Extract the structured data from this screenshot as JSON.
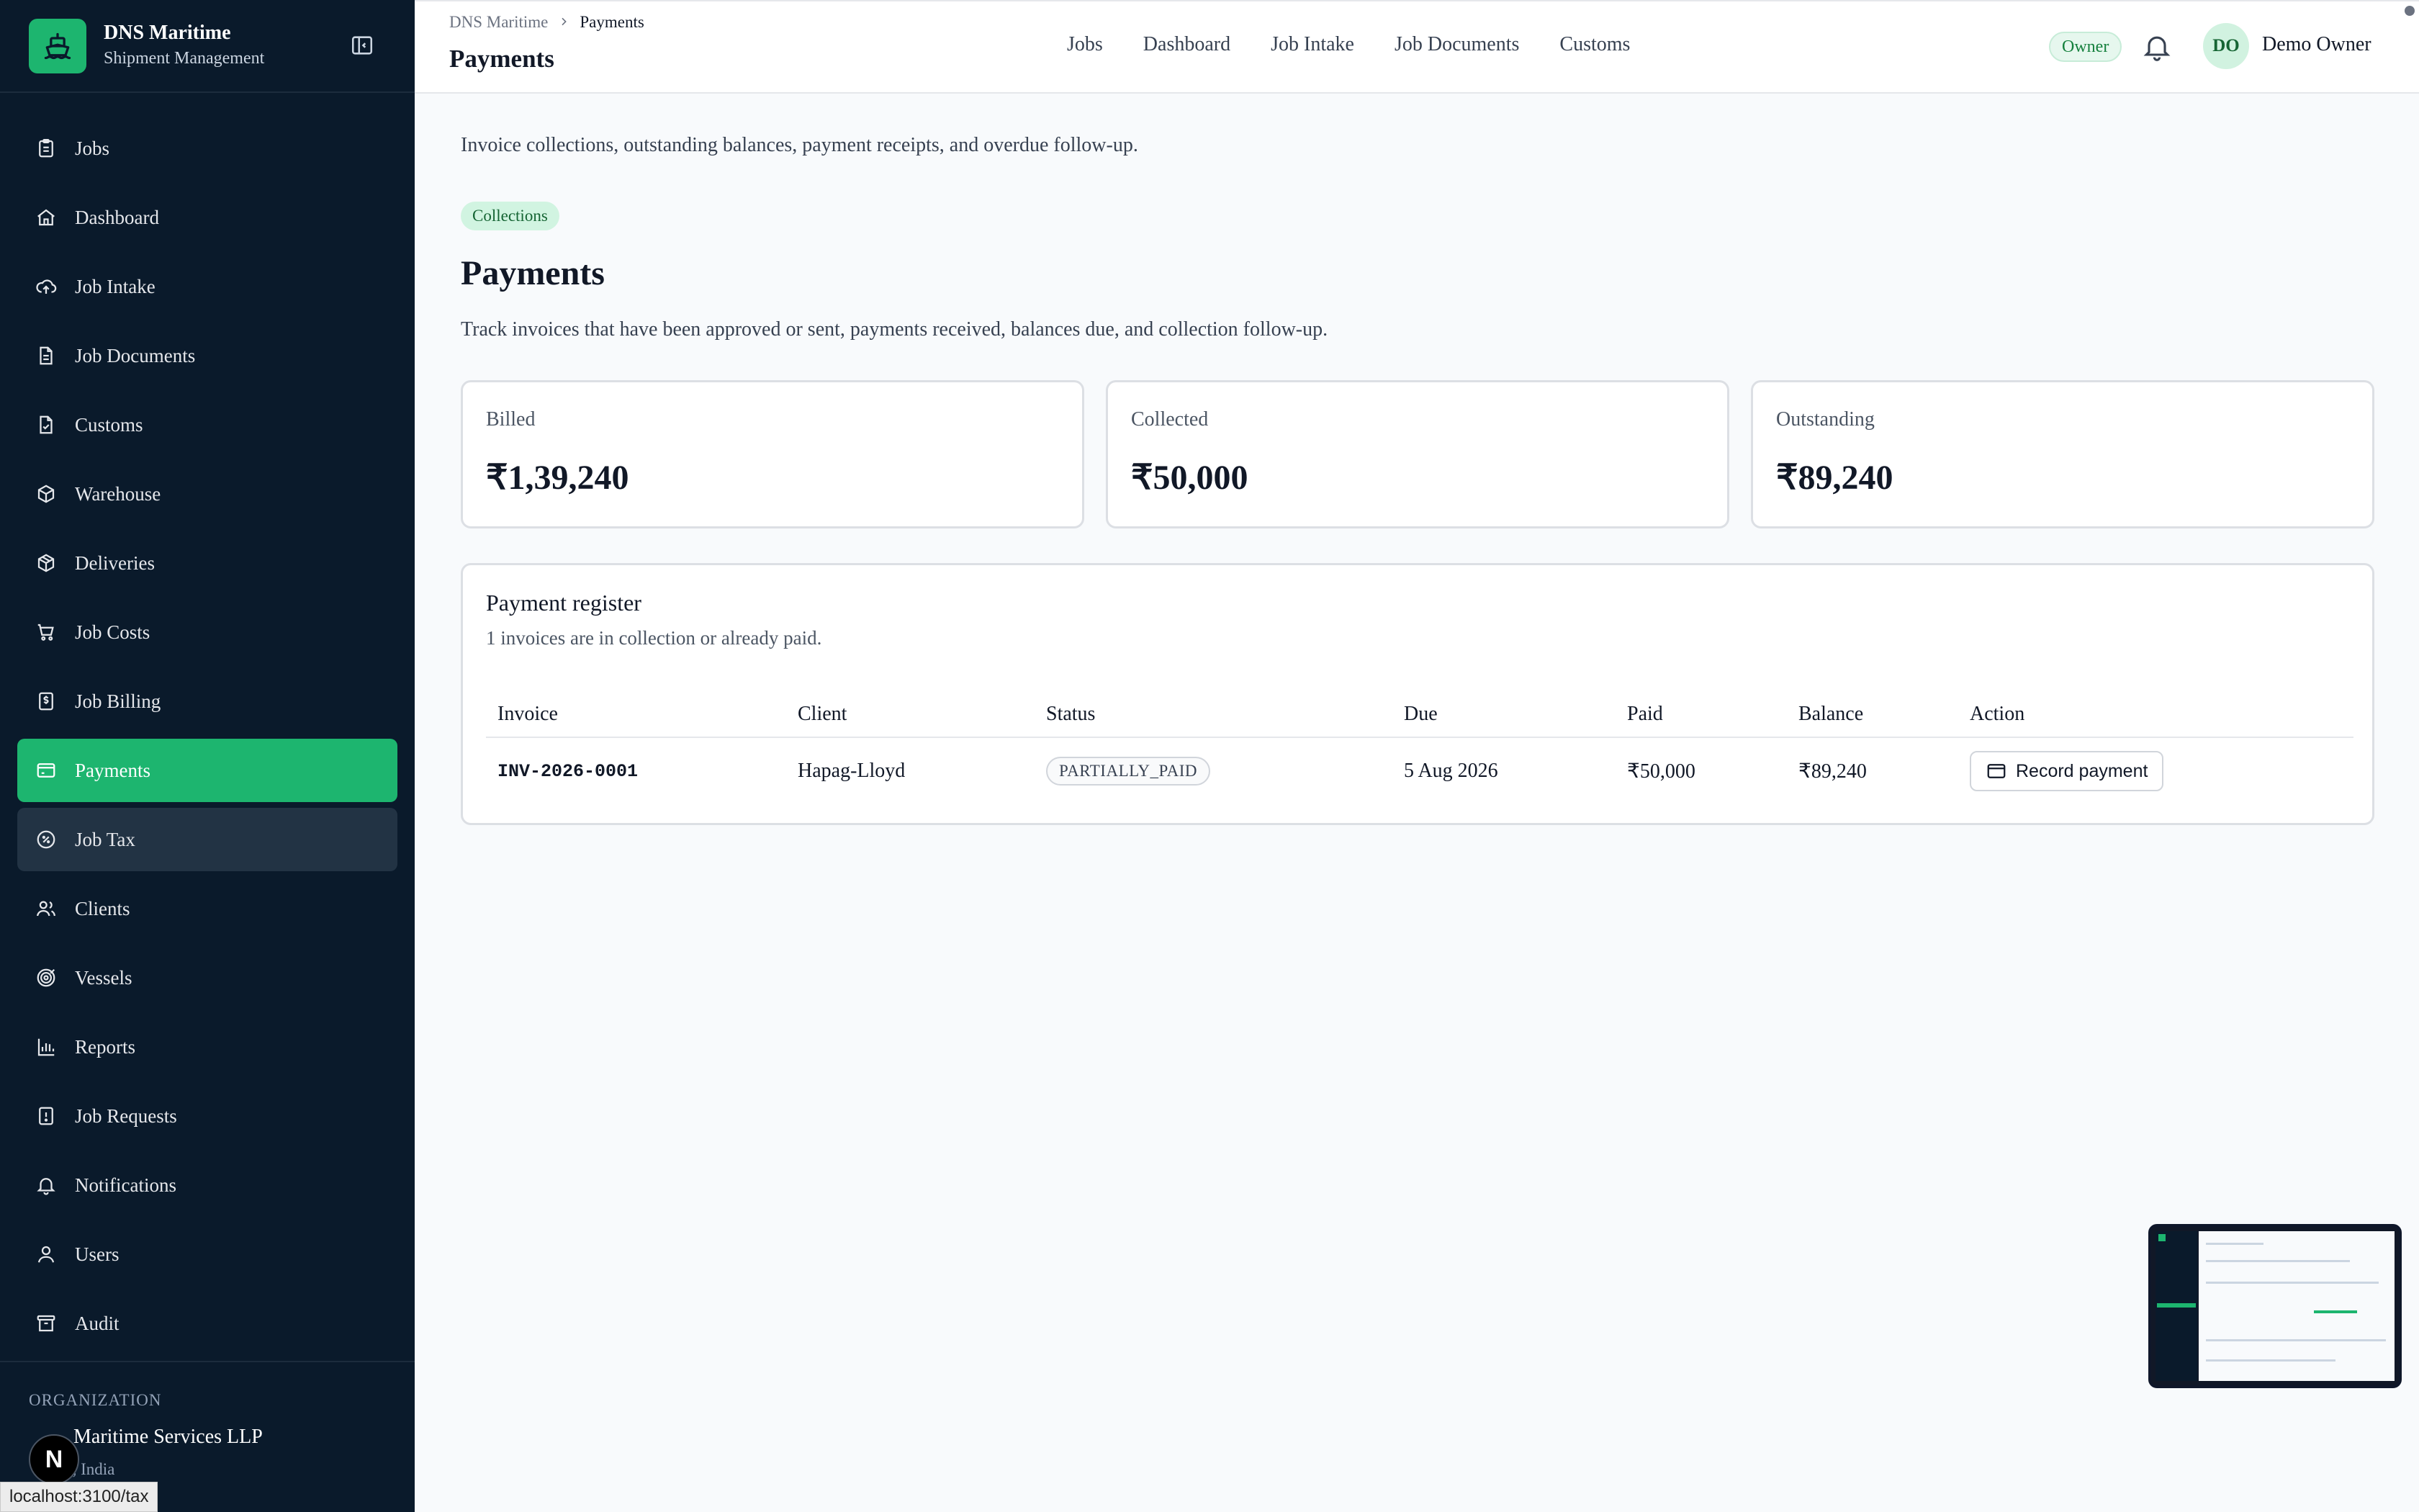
{
  "sidebar": {
    "brand_title": "DNS Maritime",
    "brand_subtitle": "Shipment Management",
    "items": [
      {
        "label": "Jobs",
        "icon": "clipboard-icon"
      },
      {
        "label": "Dashboard",
        "icon": "home-icon"
      },
      {
        "label": "Job Intake",
        "icon": "upload-cloud-icon"
      },
      {
        "label": "Job Documents",
        "icon": "document-icon"
      },
      {
        "label": "Customs",
        "icon": "file-check-icon"
      },
      {
        "label": "Warehouse",
        "icon": "package-icon"
      },
      {
        "label": "Deliveries",
        "icon": "box-icon"
      },
      {
        "label": "Job Costs",
        "icon": "cart-icon"
      },
      {
        "label": "Job Billing",
        "icon": "receipt-icon"
      },
      {
        "label": "Payments",
        "icon": "wallet-icon"
      },
      {
        "label": "Job Tax",
        "icon": "percent-badge-icon"
      },
      {
        "label": "Clients",
        "icon": "users-icon"
      },
      {
        "label": "Vessels",
        "icon": "target-icon"
      },
      {
        "label": "Reports",
        "icon": "bar-chart-icon"
      },
      {
        "label": "Job Requests",
        "icon": "alert-file-icon"
      },
      {
        "label": "Notifications",
        "icon": "bell-icon"
      },
      {
        "label": "Users",
        "icon": "user-icon"
      },
      {
        "label": "Audit",
        "icon": "archive-icon"
      }
    ],
    "active_item": "Payments",
    "hovered_item": "Job Tax",
    "org_label": "ORGANIZATION",
    "org_name": "Maritime Services LLP",
    "org_location": "ai, India"
  },
  "status_bar_url": "localhost:3100/tax",
  "topbar": {
    "breadcrumb_root": "DNS Maritime",
    "breadcrumb_current": "Payments",
    "title": "Payments",
    "nav": [
      "Jobs",
      "Dashboard",
      "Job Intake",
      "Job Documents",
      "Customs"
    ],
    "role_badge": "Owner",
    "avatar_initials": "DO",
    "user_name": "Demo Owner"
  },
  "main": {
    "intro": "Invoice collections, outstanding balances, payment receipts, and overdue follow-up.",
    "tag": "Collections",
    "heading": "Payments",
    "description": "Track invoices that have been approved or sent, payments received, balances due, and collection follow-up.",
    "stats": [
      {
        "label": "Billed",
        "value": "₹1,39,240"
      },
      {
        "label": "Collected",
        "value": "₹50,000"
      },
      {
        "label": "Outstanding",
        "value": "₹89,240"
      }
    ],
    "register": {
      "title": "Payment register",
      "subtitle": "1 invoices are in collection or already paid.",
      "columns": [
        "Invoice",
        "Client",
        "Status",
        "Due",
        "Paid",
        "Balance",
        "Action"
      ],
      "rows": [
        {
          "invoice": "INV-2026-0001",
          "client": "Hapag-Lloyd",
          "status": "PARTIALLY_PAID",
          "due": "5 Aug 2026",
          "paid": "₹50,000",
          "balance": "₹89,240",
          "action": "Record payment"
        }
      ]
    }
  },
  "colors": {
    "sidebar_bg": "#0a1a2b",
    "accent": "#1db56f",
    "page_bg": "#f8fafc"
  }
}
